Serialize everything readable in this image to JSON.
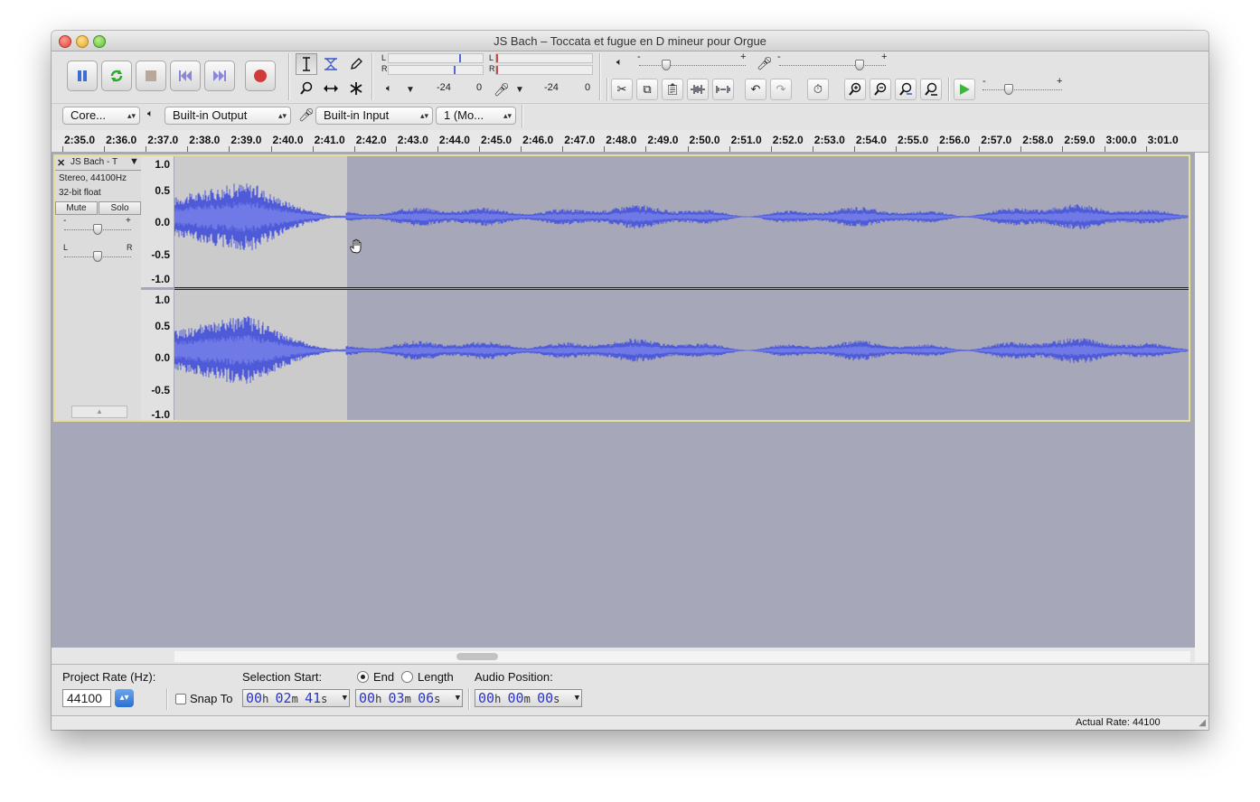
{
  "window": {
    "title": "JS Bach – Toccata et fugue en D mineur pour Orgue"
  },
  "meters": {
    "left": "L",
    "right": "R",
    "play_scale": [
      "-24",
      "0"
    ],
    "rec_scale": [
      "-24",
      "0"
    ]
  },
  "sliders": {
    "minus": "-",
    "plus": "+"
  },
  "devices": {
    "host": "Core...",
    "output": "Built-in Output",
    "input": "Built-in Input",
    "channels": "1 (Mo..."
  },
  "ruler": {
    "ticks": [
      "2:35.0",
      "2:36.0",
      "2:37.0",
      "2:38.0",
      "2:39.0",
      "2:40.0",
      "2:41.0",
      "2:42.0",
      "2:43.0",
      "2:44.0",
      "2:45.0",
      "2:46.0",
      "2:47.0",
      "2:48.0",
      "2:49.0",
      "2:50.0",
      "2:51.0",
      "2:52.0",
      "2:53.0",
      "2:54.0",
      "2:55.0",
      "2:56.0",
      "2:57.0",
      "2:58.0",
      "2:59.0",
      "3:00.0",
      "3:01.0"
    ]
  },
  "track": {
    "close": "✕",
    "name": "JS Bach - T",
    "format": "Stereo, 44100Hz",
    "bitdepth": "32-bit float",
    "mute": "Mute",
    "solo": "Solo",
    "gain_minus": "-",
    "gain_plus": "+",
    "pan_left": "L",
    "pan_right": "R",
    "scale": [
      "1.0",
      "0.5",
      "0.0",
      "-0.5",
      "-1.0"
    ],
    "wave_color": "#4e5ad8",
    "wave_light": "#6f7ae6",
    "selection_bg": "#cbcbcb",
    "unselected_bg": "#a6a7b9"
  },
  "bottom": {
    "project_rate_label": "Project Rate (Hz):",
    "project_rate": "44100",
    "snap_to": "Snap To",
    "selection_start_label": "Selection Start:",
    "end_label": "End",
    "length_label": "Length",
    "audio_position_label": "Audio Position:",
    "selection_start": {
      "h": "00",
      "m": "02",
      "s": "41"
    },
    "selection_end": {
      "h": "00",
      "m": "03",
      "s": "06"
    },
    "audio_position": {
      "h": "00",
      "m": "00",
      "s": "00"
    },
    "unit_h": "h",
    "unit_m": "m",
    "unit_s": "s"
  },
  "status": {
    "actual_rate": "Actual Rate: 44100"
  }
}
